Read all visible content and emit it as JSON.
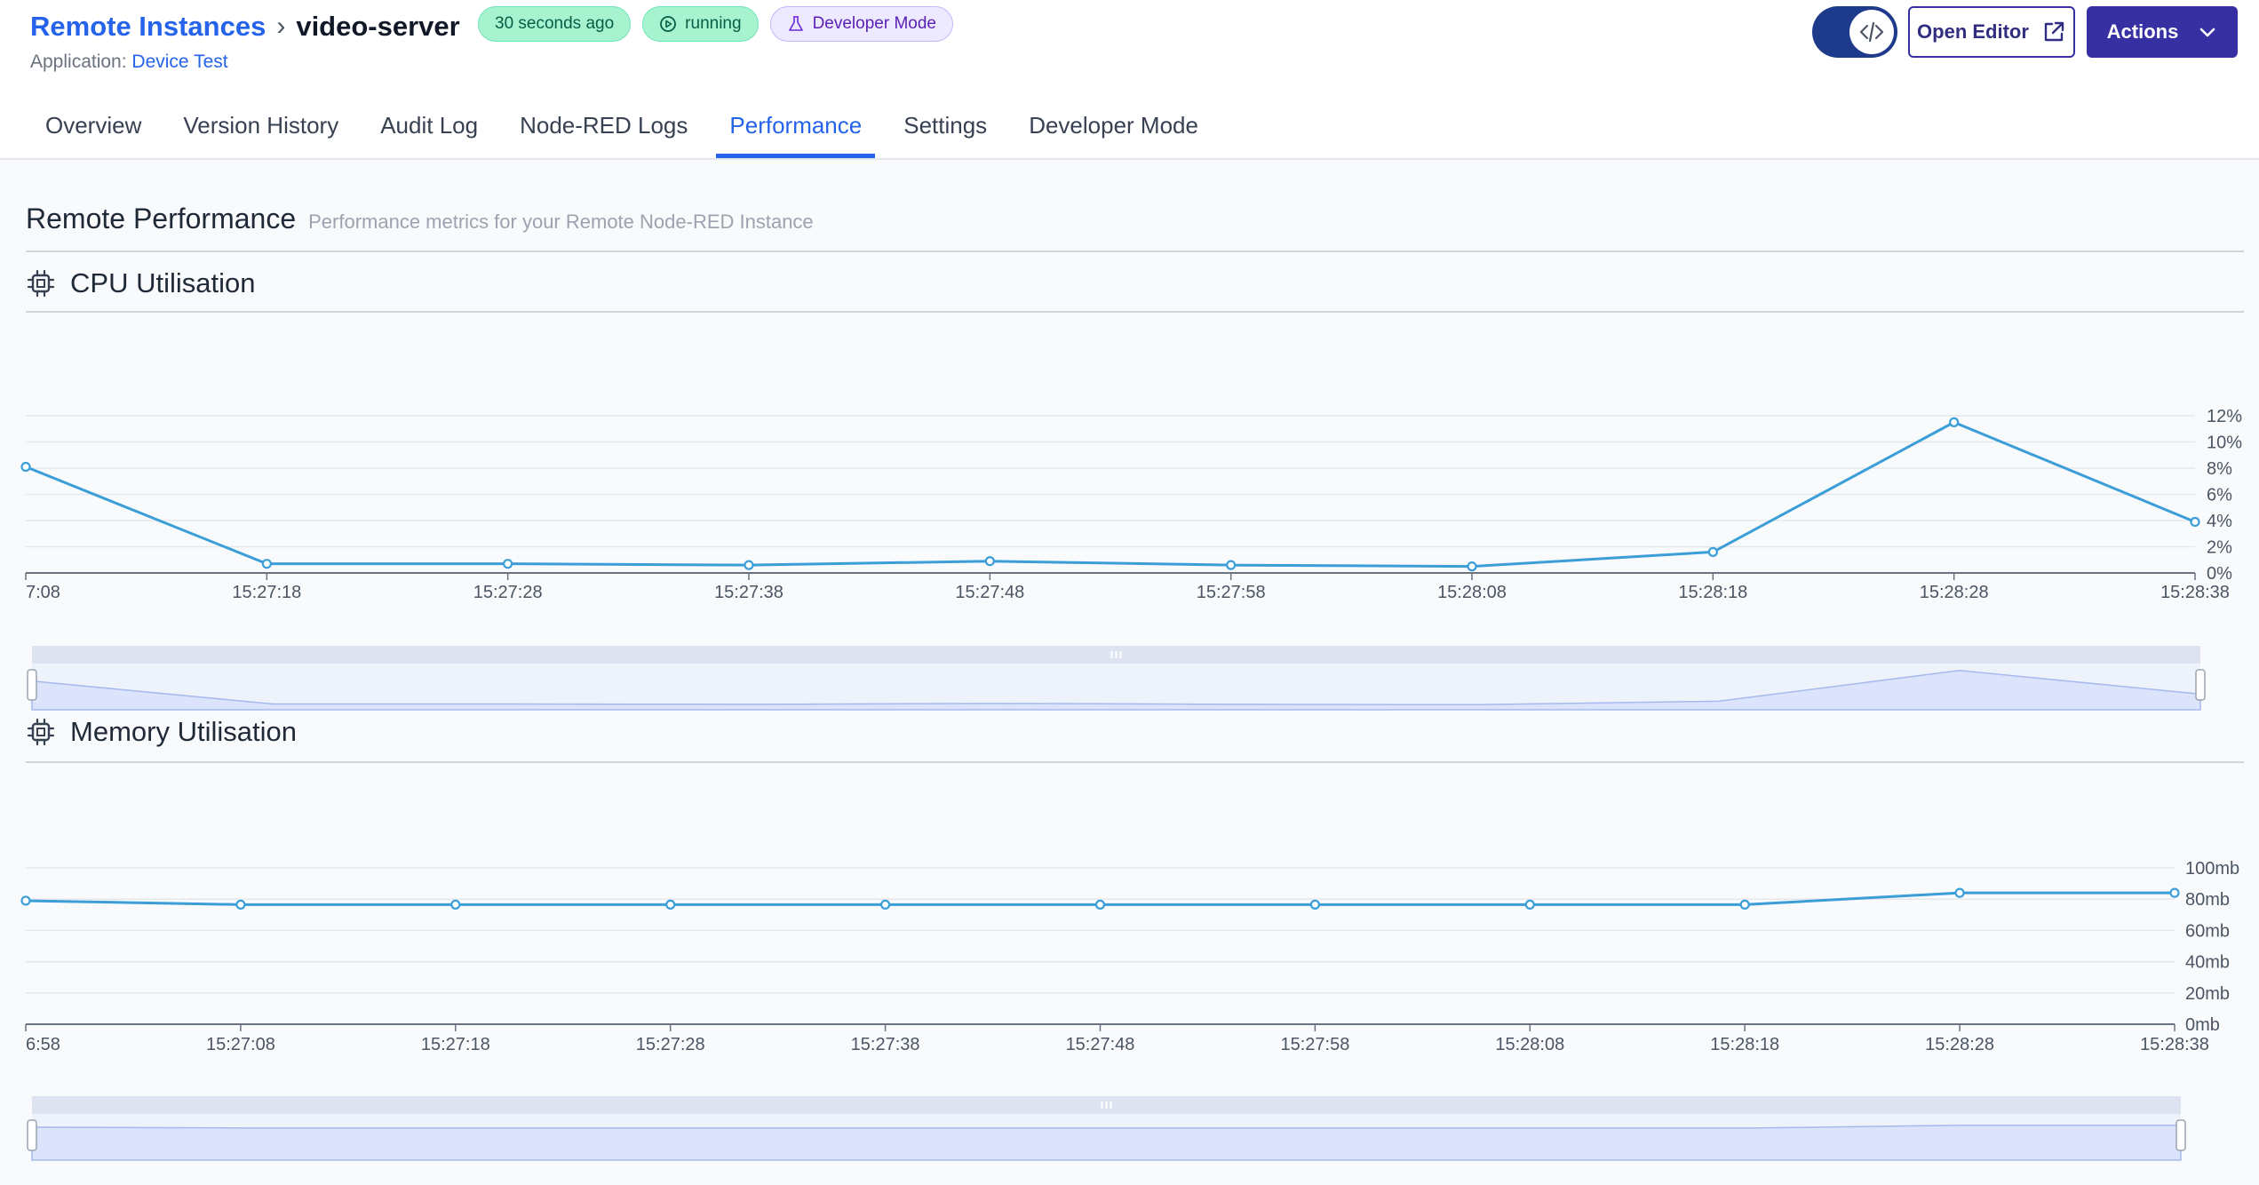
{
  "breadcrumb": {
    "parent": "Remote Instances",
    "current": "video-server"
  },
  "badges": {
    "last_seen": "30 seconds ago",
    "status": "running",
    "mode": "Developer Mode"
  },
  "application": {
    "label": "Application:",
    "name": "Device Test"
  },
  "header_buttons": {
    "open_editor": "Open Editor",
    "actions": "Actions"
  },
  "tabs": [
    {
      "label": "Overview",
      "active": false
    },
    {
      "label": "Version History",
      "active": false
    },
    {
      "label": "Audit Log",
      "active": false
    },
    {
      "label": "Node-RED Logs",
      "active": false
    },
    {
      "label": "Performance",
      "active": true
    },
    {
      "label": "Settings",
      "active": false
    },
    {
      "label": "Developer Mode",
      "active": false
    }
  ],
  "section": {
    "title": "Remote Performance",
    "subtitle": "Performance metrics for your Remote Node-RED Instance"
  },
  "colors": {
    "accent": "#2563eb",
    "primary_button": "#3730a3",
    "series_line": "#3b9ed8",
    "zoom_fill": "#dbe4fb"
  },
  "chart_data": [
    {
      "type": "line",
      "title": "CPU Utilisation",
      "icon": "cpu-chip-icon",
      "x": [
        "7:08",
        "15:27:18",
        "15:27:28",
        "15:27:38",
        "15:27:48",
        "15:27:58",
        "15:28:08",
        "15:28:18",
        "15:28:28",
        "15:28:38"
      ],
      "values": [
        8.1,
        0.7,
        0.7,
        0.6,
        0.9,
        0.6,
        0.5,
        1.6,
        11.5,
        3.9
      ],
      "y_ticks": [
        "0%",
        "2%",
        "4%",
        "6%",
        "8%",
        "10%",
        "12%"
      ],
      "ylim": [
        0,
        12
      ],
      "grid": true,
      "y_axis_side": "right",
      "zoom_slider": true
    },
    {
      "type": "line",
      "title": "Memory Utilisation",
      "icon": "cpu-chip-icon",
      "x": [
        "6:58",
        "15:27:08",
        "15:27:18",
        "15:27:28",
        "15:27:38",
        "15:27:48",
        "15:27:58",
        "15:28:08",
        "15:28:18",
        "15:28:28",
        "15:28:38"
      ],
      "values": [
        79,
        76.5,
        76.5,
        76.5,
        76.5,
        76.5,
        76.5,
        76.5,
        76.5,
        84,
        84
      ],
      "y_ticks": [
        "0mb",
        "20mb",
        "40mb",
        "60mb",
        "80mb",
        "100mb"
      ],
      "ylim": [
        0,
        100
      ],
      "grid": true,
      "y_axis_side": "right",
      "zoom_slider": true
    }
  ]
}
